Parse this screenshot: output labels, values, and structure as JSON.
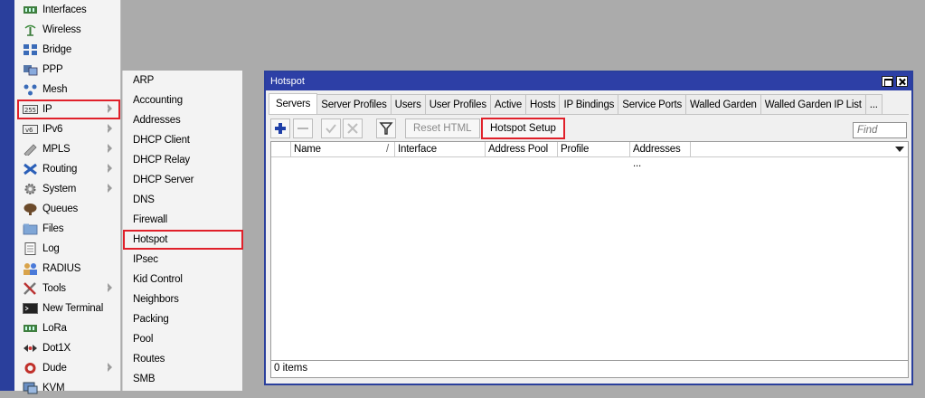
{
  "main_menu": {
    "items": [
      {
        "label": "Interfaces",
        "icon": "interfaces-icon"
      },
      {
        "label": "Wireless",
        "icon": "wireless-icon"
      },
      {
        "label": "Bridge",
        "icon": "bridge-icon"
      },
      {
        "label": "PPP",
        "icon": "ppp-icon"
      },
      {
        "label": "Mesh",
        "icon": "mesh-icon"
      },
      {
        "label": "IP",
        "icon": "ip-icon"
      },
      {
        "label": "IPv6",
        "icon": "ipv6-icon"
      },
      {
        "label": "MPLS",
        "icon": "mpls-icon"
      },
      {
        "label": "Routing",
        "icon": "routing-icon"
      },
      {
        "label": "System",
        "icon": "gear-icon"
      },
      {
        "label": "Queues",
        "icon": "queues-icon"
      },
      {
        "label": "Files",
        "icon": "folder-icon"
      },
      {
        "label": "Log",
        "icon": "log-icon"
      },
      {
        "label": "RADIUS",
        "icon": "radius-icon"
      },
      {
        "label": "Tools",
        "icon": "tools-icon"
      },
      {
        "label": "New Terminal",
        "icon": "terminal-icon"
      },
      {
        "label": "LoRa",
        "icon": "lora-icon"
      },
      {
        "label": "Dot1X",
        "icon": "dot1x-icon"
      },
      {
        "label": "Dude",
        "icon": "dude-icon"
      },
      {
        "label": "KVM",
        "icon": "kvm-icon"
      }
    ]
  },
  "ip_submenu": {
    "items": [
      "ARP",
      "Accounting",
      "Addresses",
      "DHCP Client",
      "DHCP Relay",
      "DHCP Server",
      "DNS",
      "Firewall",
      "Hotspot",
      "IPsec",
      "Kid Control",
      "Neighbors",
      "Packing",
      "Pool",
      "Routes",
      "SMB"
    ]
  },
  "hotspot_window": {
    "title": "Hotspot",
    "tabs": [
      "Servers",
      "Server Profiles",
      "Users",
      "User Profiles",
      "Active",
      "Hosts",
      "IP Bindings",
      "Service Ports",
      "Walled Garden",
      "Walled Garden IP List",
      "..."
    ],
    "toolbar": {
      "reset_html": "Reset HTML",
      "hotspot_setup": "Hotspot Setup",
      "find_placeholder": "Find"
    },
    "columns": [
      "Name",
      "Interface",
      "Address Pool",
      "Profile",
      "Addresses ..."
    ],
    "status": "0 items"
  },
  "colors": {
    "titlebar": "#2d3fa6",
    "highlight": "#e0202a",
    "desktop": "#ababab"
  }
}
